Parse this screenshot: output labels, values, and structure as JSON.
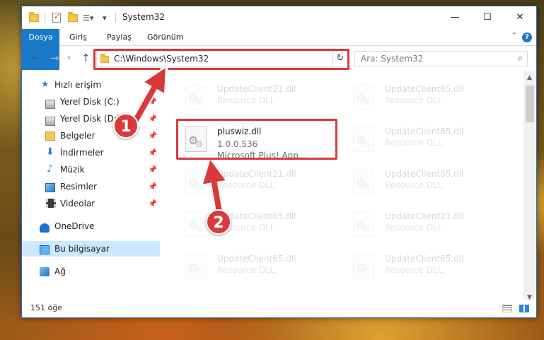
{
  "window": {
    "title": "System32",
    "controls": {
      "minimize": "—",
      "maximize": "☐",
      "close": "✕"
    }
  },
  "ribbon": {
    "tabs": [
      "Dosya",
      "Giriş",
      "Paylaş",
      "Görünüm"
    ],
    "help": "?"
  },
  "address": {
    "path": "C:\\Windows\\System32",
    "search_placeholder": "Ara: System32"
  },
  "nav_pane": {
    "quick_access": "Hızlı erişim",
    "items": [
      {
        "label": "Yerel Disk (C:)",
        "icon": "drive-icon",
        "pinned": true
      },
      {
        "label": "Yerel Disk (D:)",
        "icon": "drive-icon",
        "pinned": true
      },
      {
        "label": "Belgeler",
        "icon": "documents-icon",
        "pinned": true
      },
      {
        "label": "İndirmeler",
        "icon": "downloads-icon",
        "pinned": true
      },
      {
        "label": "Müzik",
        "icon": "music-icon",
        "pinned": true
      },
      {
        "label": "Resimler",
        "icon": "pictures-icon",
        "pinned": true
      },
      {
        "label": "Videolar",
        "icon": "videos-icon",
        "pinned": true
      }
    ],
    "onedrive": "OneDrive",
    "this_pc": "Bu bilgisayar",
    "network": "Ağ"
  },
  "files": {
    "highlighted": {
      "name": "pluswiz.dll",
      "version": "1.0.0.536",
      "description": "Microsoft Plus! App..."
    },
    "background": [
      {
        "name": "UpdateClient21.dll",
        "type": "Resource DLL"
      },
      {
        "name": "UpdateClient65.dll",
        "type": "Resource DLL"
      },
      {
        "name": "UpdateClient65.dll",
        "type": "Resource DLL"
      },
      {
        "name": "UpdateClient21.dll",
        "type": "Resource DLL"
      },
      {
        "name": "UpdateClient65.dll",
        "type": "Resource DLL"
      },
      {
        "name": "UpdateClient65.dll",
        "type": "Resource DLL"
      },
      {
        "name": "UpdateClient21.dll",
        "type": "Resource DLL"
      },
      {
        "name": "UpdateClient65.dll",
        "type": "Resource DLL"
      },
      {
        "name": "UpdateClient65.dll",
        "type": "Resource DLL"
      }
    ]
  },
  "status": {
    "count": "151 öğe"
  },
  "callouts": [
    "1",
    "2"
  ],
  "colors": {
    "accent": "#1979ca",
    "highlight": "#d9393b",
    "selection": "#cce8ff"
  }
}
